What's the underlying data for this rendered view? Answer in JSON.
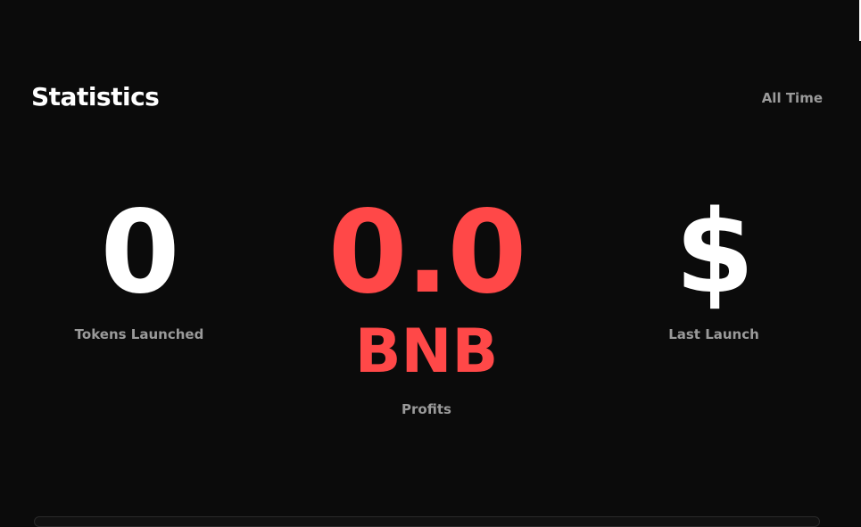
{
  "header": {
    "title": "Statistics",
    "range": "All Time"
  },
  "stats": {
    "tokens": {
      "value": "0",
      "label": "Tokens Launched"
    },
    "profits": {
      "value": "0.0",
      "unit": "BNB",
      "label": "Profits"
    },
    "last_launch": {
      "value": "$",
      "label": "Last Launch"
    }
  },
  "colors": {
    "background": "#0b0b0b",
    "accent": "#ff4848",
    "muted_text": "#9a9a9a"
  }
}
